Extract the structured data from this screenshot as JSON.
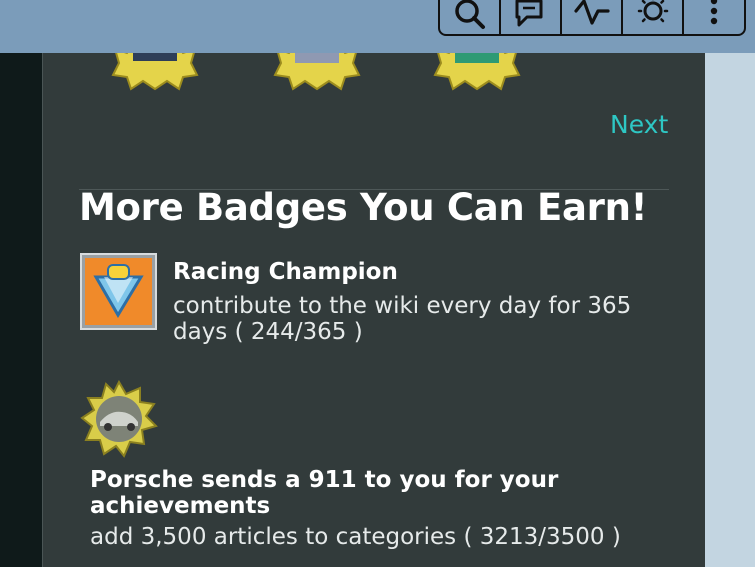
{
  "toolbar": {
    "buttons": [
      {
        "icon": "search-icon"
      },
      {
        "icon": "discussion-icon"
      },
      {
        "icon": "activity-icon"
      },
      {
        "icon": "theme-icon"
      },
      {
        "icon": "more-icon"
      }
    ]
  },
  "main": {
    "next_label": "Next",
    "heading": "More Badges You Can Earn!",
    "badges": [
      {
        "title": "Racing Champion",
        "description": "contribute to the wiki every day for 365 days ( 244/365 )"
      },
      {
        "title": "Porsche sends a 911 to you for your achievements",
        "description": "add 3,500 articles to categories ( 3213/3500 )"
      }
    ]
  },
  "colors": {
    "accent_link": "#2ec7c4",
    "panel_bg": "#323b3b",
    "topbar_bg": "#7b9cba"
  }
}
